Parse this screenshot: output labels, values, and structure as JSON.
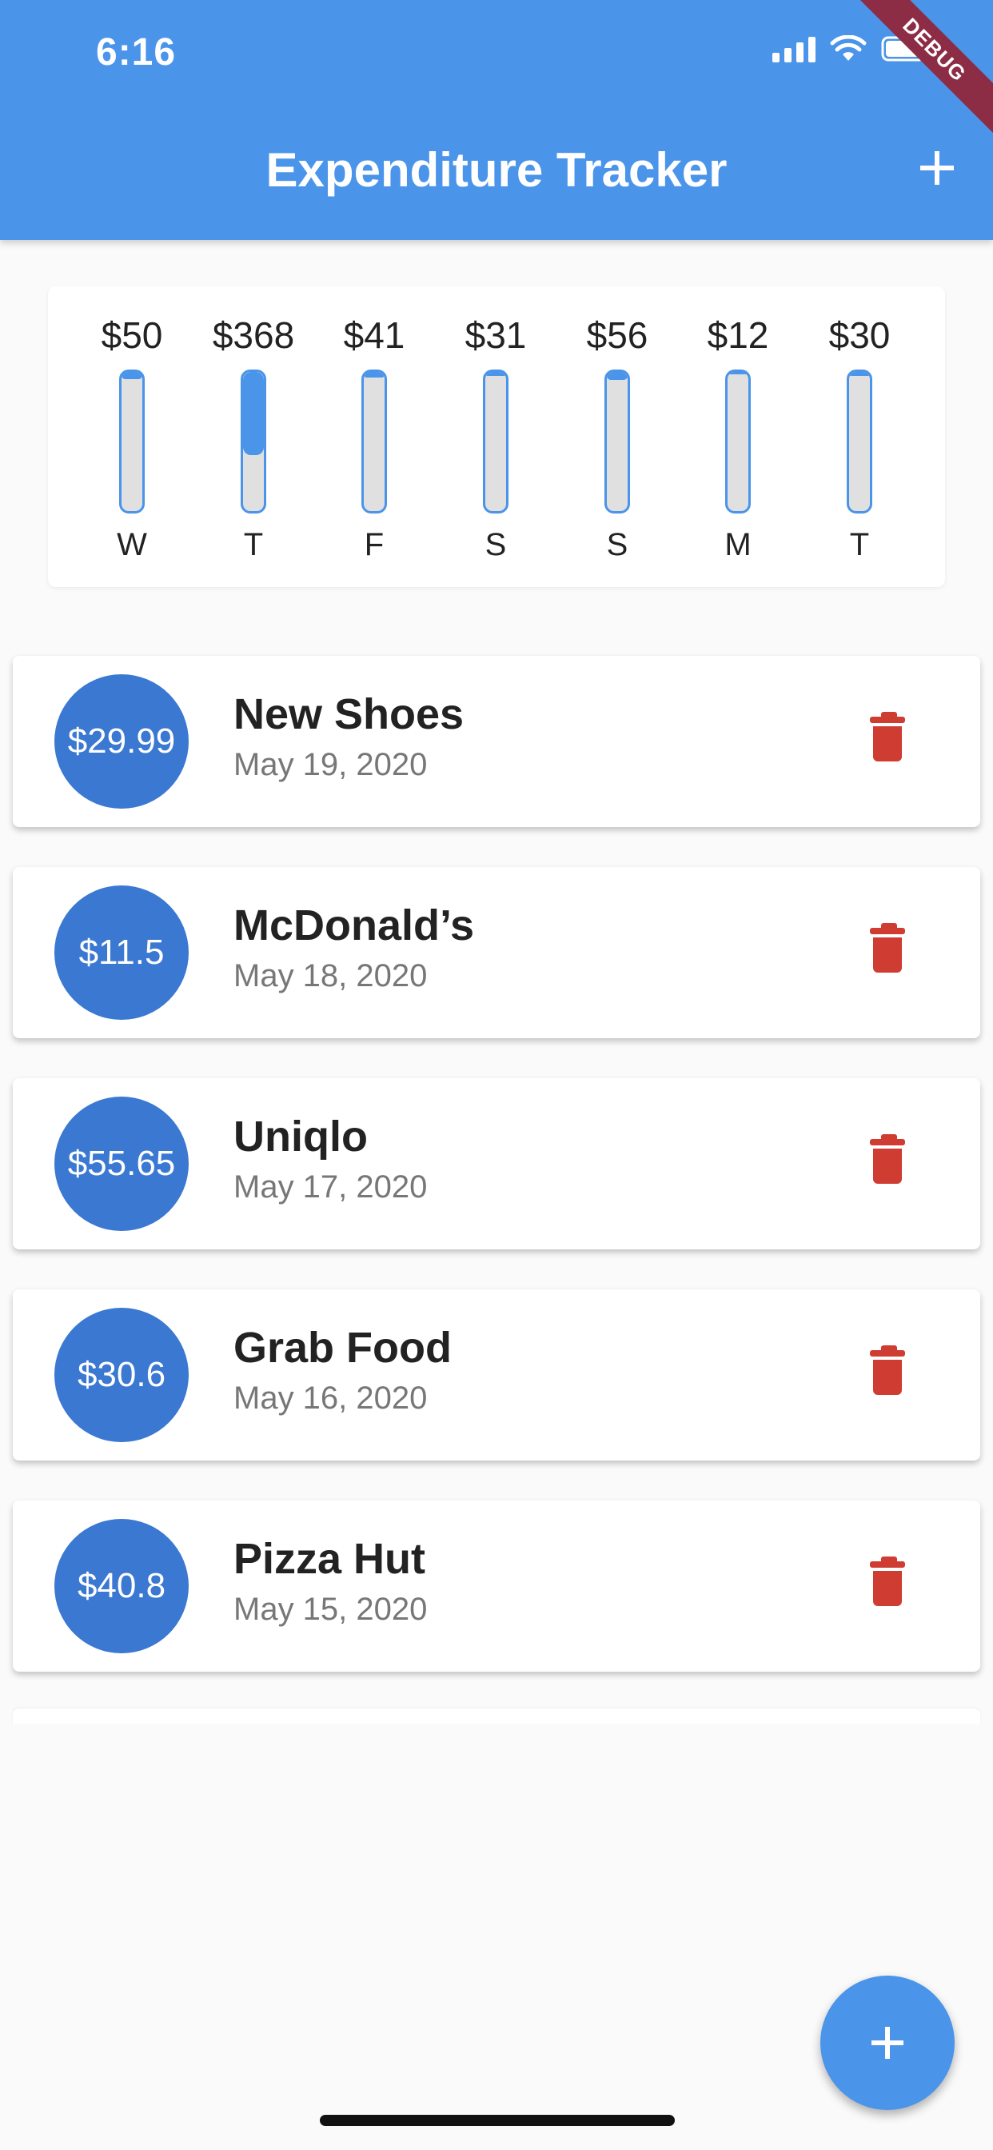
{
  "status_bar": {
    "time": "6:16"
  },
  "app_bar": {
    "title": "Expenditure Tracker",
    "debug_banner": "DEBUG"
  },
  "chart_data": {
    "type": "bar",
    "categories": [
      "W",
      "T",
      "F",
      "S",
      "S",
      "M",
      "T"
    ],
    "values": [
      50,
      368,
      41,
      31,
      56,
      12,
      30
    ],
    "value_labels": [
      "$50",
      "$368",
      "$41",
      "$31",
      "$56",
      "$12",
      "$30"
    ],
    "fill_fractions": [
      0.05,
      0.6,
      0.04,
      0.03,
      0.06,
      0.01,
      0.03
    ],
    "title": "",
    "xlabel": "",
    "ylabel": "",
    "colors": {
      "fill": "#4a94ea",
      "track": "#e0e0e0"
    }
  },
  "transactions": [
    {
      "amount": "$29.99",
      "title": "New Shoes",
      "date": "May 19, 2020"
    },
    {
      "amount": "$11.5",
      "title": "McDonald’s",
      "date": "May 18, 2020"
    },
    {
      "amount": "$55.65",
      "title": "Uniqlo",
      "date": "May 17, 2020"
    },
    {
      "amount": "$30.6",
      "title": "Grab Food",
      "date": "May 16, 2020"
    },
    {
      "amount": "$40.8",
      "title": "Pizza Hut",
      "date": "May 15, 2020"
    }
  ],
  "icons": {
    "add": "plus-icon",
    "delete": "trash-icon",
    "fab": "plus-icon"
  },
  "colors": {
    "app_bar": "#4a94ea",
    "circle": "#3a78d2",
    "delete": "#cf3c32",
    "debug": "#8c2c45"
  }
}
